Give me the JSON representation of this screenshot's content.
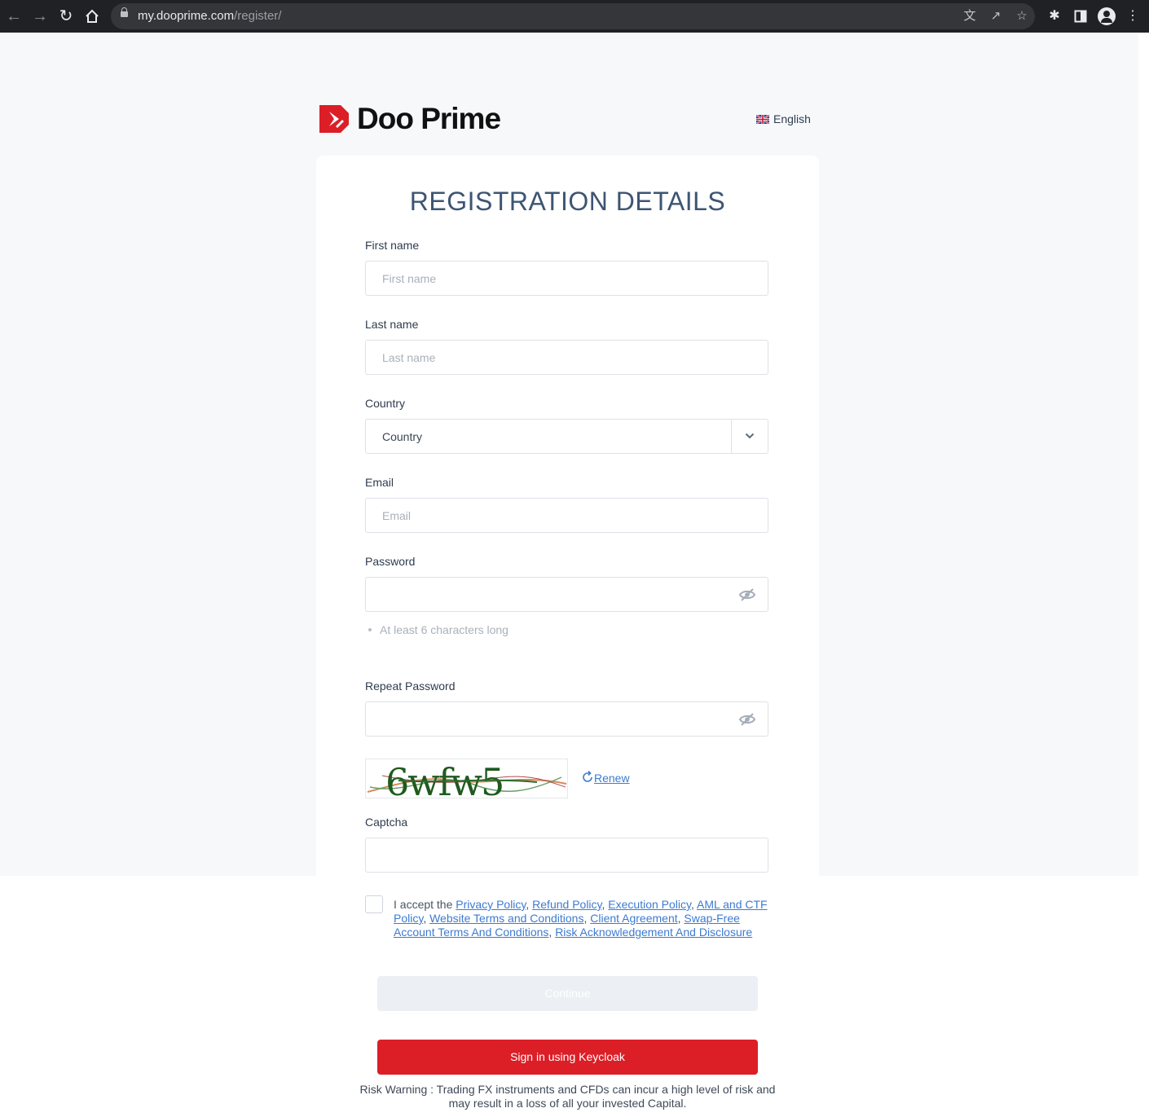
{
  "browser": {
    "url_host": "my.dooprime.com",
    "url_path": "/register/"
  },
  "header": {
    "brand": "Doo Prime",
    "language": "English"
  },
  "form": {
    "title": "REGISTRATION DETAILS",
    "first_name": {
      "label": "First name",
      "placeholder": "First name"
    },
    "last_name": {
      "label": "Last name",
      "placeholder": "Last name"
    },
    "country": {
      "label": "Country",
      "value": "Country"
    },
    "email": {
      "label": "Email",
      "placeholder": "Email"
    },
    "password": {
      "label": "Password",
      "hint": "At least 6 characters long"
    },
    "repeat_password": {
      "label": "Repeat Password"
    },
    "captcha": {
      "image_text": "6wfw5",
      "renew_label": "Renew",
      "label": "Captcha"
    },
    "terms": {
      "prefix": "I accept the ",
      "links": [
        "Privacy Policy",
        "Refund Policy",
        "Execution Policy",
        "AML and CTF Policy",
        "Website Terms and Conditions",
        "Client Agreement",
        "Swap-Free Account Terms And Conditions",
        "Risk Acknowledgement And Disclosure"
      ]
    },
    "continue_label": "Continue",
    "keycloak_label": "Sign in using Keycloak",
    "risk_warning": "Risk Warning : Trading FX instruments and CFDs can incur a high level of risk and may result in a loss of all your invested Capital."
  },
  "colors": {
    "brand_red": "#dc1e27",
    "link_blue": "#3d7bd0",
    "title": "#3d5573"
  }
}
